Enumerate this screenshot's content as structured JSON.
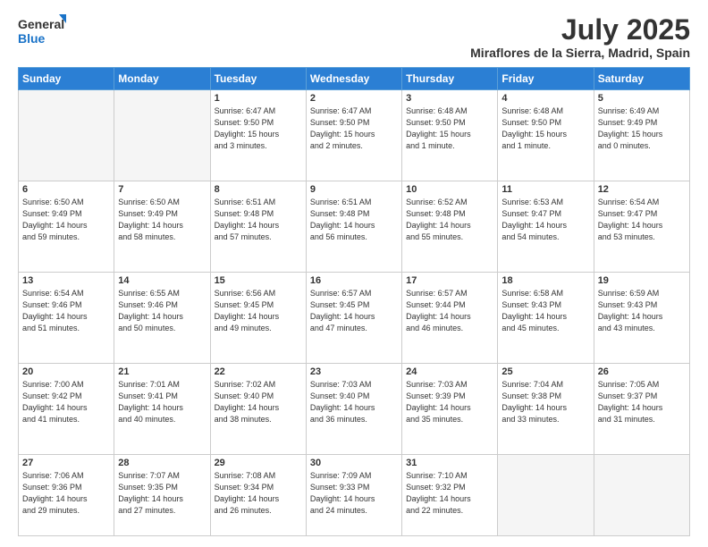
{
  "header": {
    "logo_line1": "General",
    "logo_line2": "Blue",
    "month_year": "July 2025",
    "location": "Miraflores de la Sierra, Madrid, Spain"
  },
  "days_of_week": [
    "Sunday",
    "Monday",
    "Tuesday",
    "Wednesday",
    "Thursday",
    "Friday",
    "Saturday"
  ],
  "weeks": [
    [
      {
        "num": "",
        "info": ""
      },
      {
        "num": "",
        "info": ""
      },
      {
        "num": "1",
        "info": "Sunrise: 6:47 AM\nSunset: 9:50 PM\nDaylight: 15 hours\nand 3 minutes."
      },
      {
        "num": "2",
        "info": "Sunrise: 6:47 AM\nSunset: 9:50 PM\nDaylight: 15 hours\nand 2 minutes."
      },
      {
        "num": "3",
        "info": "Sunrise: 6:48 AM\nSunset: 9:50 PM\nDaylight: 15 hours\nand 1 minute."
      },
      {
        "num": "4",
        "info": "Sunrise: 6:48 AM\nSunset: 9:50 PM\nDaylight: 15 hours\nand 1 minute."
      },
      {
        "num": "5",
        "info": "Sunrise: 6:49 AM\nSunset: 9:49 PM\nDaylight: 15 hours\nand 0 minutes."
      }
    ],
    [
      {
        "num": "6",
        "info": "Sunrise: 6:50 AM\nSunset: 9:49 PM\nDaylight: 14 hours\nand 59 minutes."
      },
      {
        "num": "7",
        "info": "Sunrise: 6:50 AM\nSunset: 9:49 PM\nDaylight: 14 hours\nand 58 minutes."
      },
      {
        "num": "8",
        "info": "Sunrise: 6:51 AM\nSunset: 9:48 PM\nDaylight: 14 hours\nand 57 minutes."
      },
      {
        "num": "9",
        "info": "Sunrise: 6:51 AM\nSunset: 9:48 PM\nDaylight: 14 hours\nand 56 minutes."
      },
      {
        "num": "10",
        "info": "Sunrise: 6:52 AM\nSunset: 9:48 PM\nDaylight: 14 hours\nand 55 minutes."
      },
      {
        "num": "11",
        "info": "Sunrise: 6:53 AM\nSunset: 9:47 PM\nDaylight: 14 hours\nand 54 minutes."
      },
      {
        "num": "12",
        "info": "Sunrise: 6:54 AM\nSunset: 9:47 PM\nDaylight: 14 hours\nand 53 minutes."
      }
    ],
    [
      {
        "num": "13",
        "info": "Sunrise: 6:54 AM\nSunset: 9:46 PM\nDaylight: 14 hours\nand 51 minutes."
      },
      {
        "num": "14",
        "info": "Sunrise: 6:55 AM\nSunset: 9:46 PM\nDaylight: 14 hours\nand 50 minutes."
      },
      {
        "num": "15",
        "info": "Sunrise: 6:56 AM\nSunset: 9:45 PM\nDaylight: 14 hours\nand 49 minutes."
      },
      {
        "num": "16",
        "info": "Sunrise: 6:57 AM\nSunset: 9:45 PM\nDaylight: 14 hours\nand 47 minutes."
      },
      {
        "num": "17",
        "info": "Sunrise: 6:57 AM\nSunset: 9:44 PM\nDaylight: 14 hours\nand 46 minutes."
      },
      {
        "num": "18",
        "info": "Sunrise: 6:58 AM\nSunset: 9:43 PM\nDaylight: 14 hours\nand 45 minutes."
      },
      {
        "num": "19",
        "info": "Sunrise: 6:59 AM\nSunset: 9:43 PM\nDaylight: 14 hours\nand 43 minutes."
      }
    ],
    [
      {
        "num": "20",
        "info": "Sunrise: 7:00 AM\nSunset: 9:42 PM\nDaylight: 14 hours\nand 41 minutes."
      },
      {
        "num": "21",
        "info": "Sunrise: 7:01 AM\nSunset: 9:41 PM\nDaylight: 14 hours\nand 40 minutes."
      },
      {
        "num": "22",
        "info": "Sunrise: 7:02 AM\nSunset: 9:40 PM\nDaylight: 14 hours\nand 38 minutes."
      },
      {
        "num": "23",
        "info": "Sunrise: 7:03 AM\nSunset: 9:40 PM\nDaylight: 14 hours\nand 36 minutes."
      },
      {
        "num": "24",
        "info": "Sunrise: 7:03 AM\nSunset: 9:39 PM\nDaylight: 14 hours\nand 35 minutes."
      },
      {
        "num": "25",
        "info": "Sunrise: 7:04 AM\nSunset: 9:38 PM\nDaylight: 14 hours\nand 33 minutes."
      },
      {
        "num": "26",
        "info": "Sunrise: 7:05 AM\nSunset: 9:37 PM\nDaylight: 14 hours\nand 31 minutes."
      }
    ],
    [
      {
        "num": "27",
        "info": "Sunrise: 7:06 AM\nSunset: 9:36 PM\nDaylight: 14 hours\nand 29 minutes."
      },
      {
        "num": "28",
        "info": "Sunrise: 7:07 AM\nSunset: 9:35 PM\nDaylight: 14 hours\nand 27 minutes."
      },
      {
        "num": "29",
        "info": "Sunrise: 7:08 AM\nSunset: 9:34 PM\nDaylight: 14 hours\nand 26 minutes."
      },
      {
        "num": "30",
        "info": "Sunrise: 7:09 AM\nSunset: 9:33 PM\nDaylight: 14 hours\nand 24 minutes."
      },
      {
        "num": "31",
        "info": "Sunrise: 7:10 AM\nSunset: 9:32 PM\nDaylight: 14 hours\nand 22 minutes."
      },
      {
        "num": "",
        "info": ""
      },
      {
        "num": "",
        "info": ""
      }
    ]
  ]
}
